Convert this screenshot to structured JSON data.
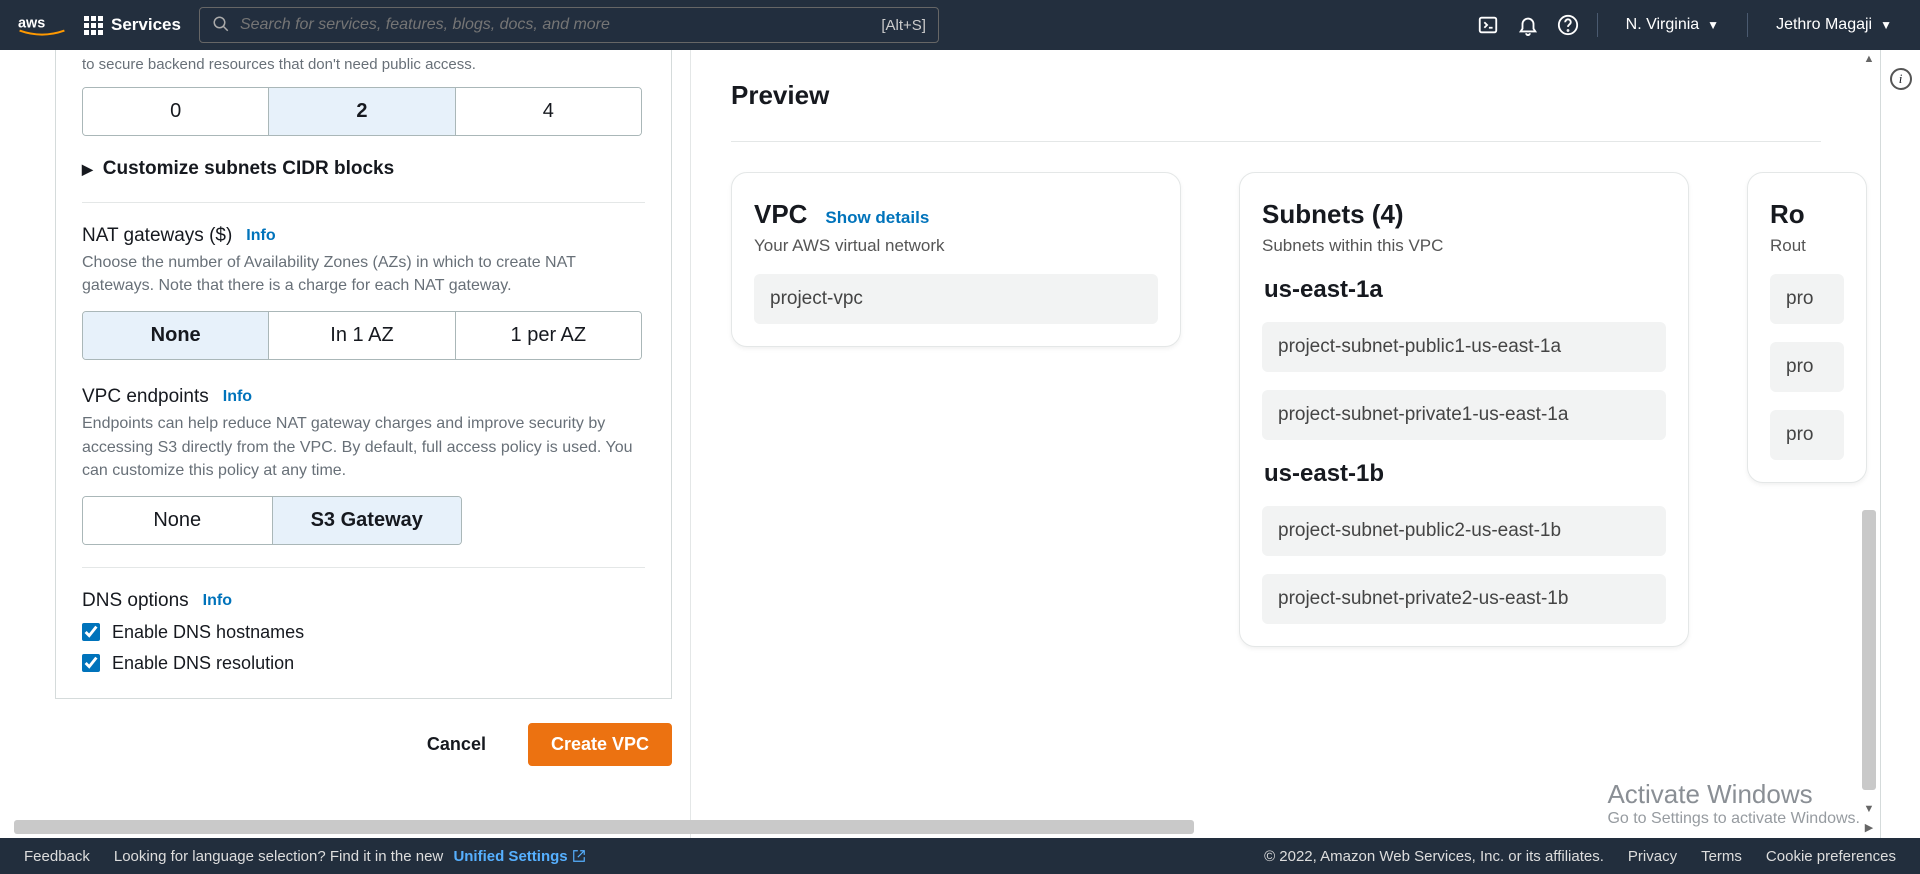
{
  "nav": {
    "services": "Services",
    "search_placeholder": "Search for services, features, blogs, docs, and more",
    "search_hint": "[Alt+S]",
    "region": "N. Virginia",
    "user": "Jethro Magaji"
  },
  "form": {
    "private_desc_tail": "to secure backend resources that don't need public access.",
    "subnet_options": [
      "0",
      "2",
      "4"
    ],
    "subnet_selected": "2",
    "customize_label": "Customize subnets CIDR blocks",
    "nat": {
      "title": "NAT gateways ($)",
      "info": "Info",
      "desc": "Choose the number of Availability Zones (AZs) in which to create NAT gateways. Note that there is a charge for each NAT gateway.",
      "options": [
        "None",
        "In 1 AZ",
        "1 per AZ"
      ],
      "selected": "None"
    },
    "vpce": {
      "title": "VPC endpoints",
      "info": "Info",
      "desc": "Endpoints can help reduce NAT gateway charges and improve security by accessing S3 directly from the VPC. By default, full access policy is used. You can customize this policy at any time.",
      "options": [
        "None",
        "S3 Gateway"
      ],
      "selected": "S3 Gateway"
    },
    "dns": {
      "title": "DNS options",
      "info": "Info",
      "hostnames": "Enable DNS hostnames",
      "resolution": "Enable DNS resolution"
    },
    "cancel": "Cancel",
    "create": "Create VPC"
  },
  "preview": {
    "title": "Preview",
    "vpc": {
      "title": "VPC",
      "show": "Show details",
      "sub": "Your AWS virtual network",
      "name": "project-vpc"
    },
    "subnets": {
      "title": "Subnets (4)",
      "sub": "Subnets within this VPC",
      "azs": [
        {
          "az": "us-east-1a",
          "items": [
            "project-subnet-public1-us-east-1a",
            "project-subnet-private1-us-east-1a"
          ]
        },
        {
          "az": "us-east-1b",
          "items": [
            "project-subnet-public2-us-east-1b",
            "project-subnet-private2-us-east-1b"
          ]
        }
      ]
    },
    "routes": {
      "title": "Ro",
      "sub": "Rout",
      "items": [
        "pro",
        "pro",
        "pro"
      ]
    }
  },
  "footer": {
    "feedback": "Feedback",
    "lang": "Looking for language selection? Find it in the new",
    "unified": "Unified Settings",
    "copyright": "© 2022, Amazon Web Services, Inc. or its affiliates.",
    "privacy": "Privacy",
    "terms": "Terms",
    "cookie": "Cookie preferences"
  },
  "watermark": {
    "l1": "Activate Windows",
    "l2": "Go to Settings to activate Windows."
  }
}
